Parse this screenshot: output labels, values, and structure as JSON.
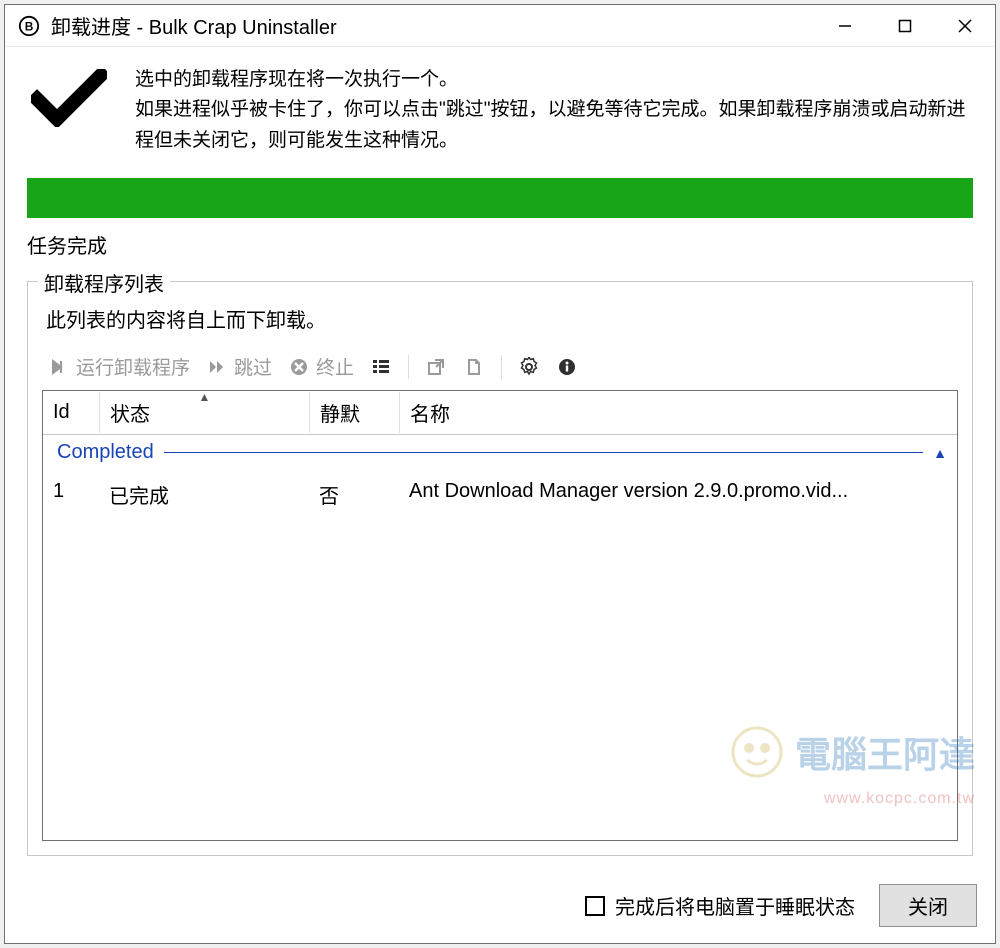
{
  "titlebar": {
    "title": "卸载进度 - Bulk Crap Uninstaller"
  },
  "info": {
    "line1": "选中的卸载程序现在将一次执行一个。",
    "line2": "如果进程似乎被卡住了，你可以点击\"跳过\"按钮，以避免等待它完成。如果卸载程序崩溃或启动新进程但未关闭它，则可能发生这种情况。"
  },
  "status": "任务完成",
  "groupbox": {
    "legend": "卸载程序列表",
    "caption": "此列表的内容将自上而下卸载。"
  },
  "toolbar": {
    "run": "运行卸载程序",
    "skip": "跳过",
    "stop": "终止"
  },
  "table": {
    "headers": {
      "id": "Id",
      "status": "状态",
      "silent": "静默",
      "name": "名称"
    },
    "group": "Completed",
    "rows": [
      {
        "id": "1",
        "status": "已完成",
        "silent": "否",
        "name": "Ant Download Manager version 2.9.0.promo.vid..."
      }
    ]
  },
  "footer": {
    "sleep": "完成后将电脑置于睡眠状态",
    "close": "关闭"
  },
  "watermark": {
    "main": "電腦王阿達",
    "sub": "www.kocpc.com.tw"
  }
}
